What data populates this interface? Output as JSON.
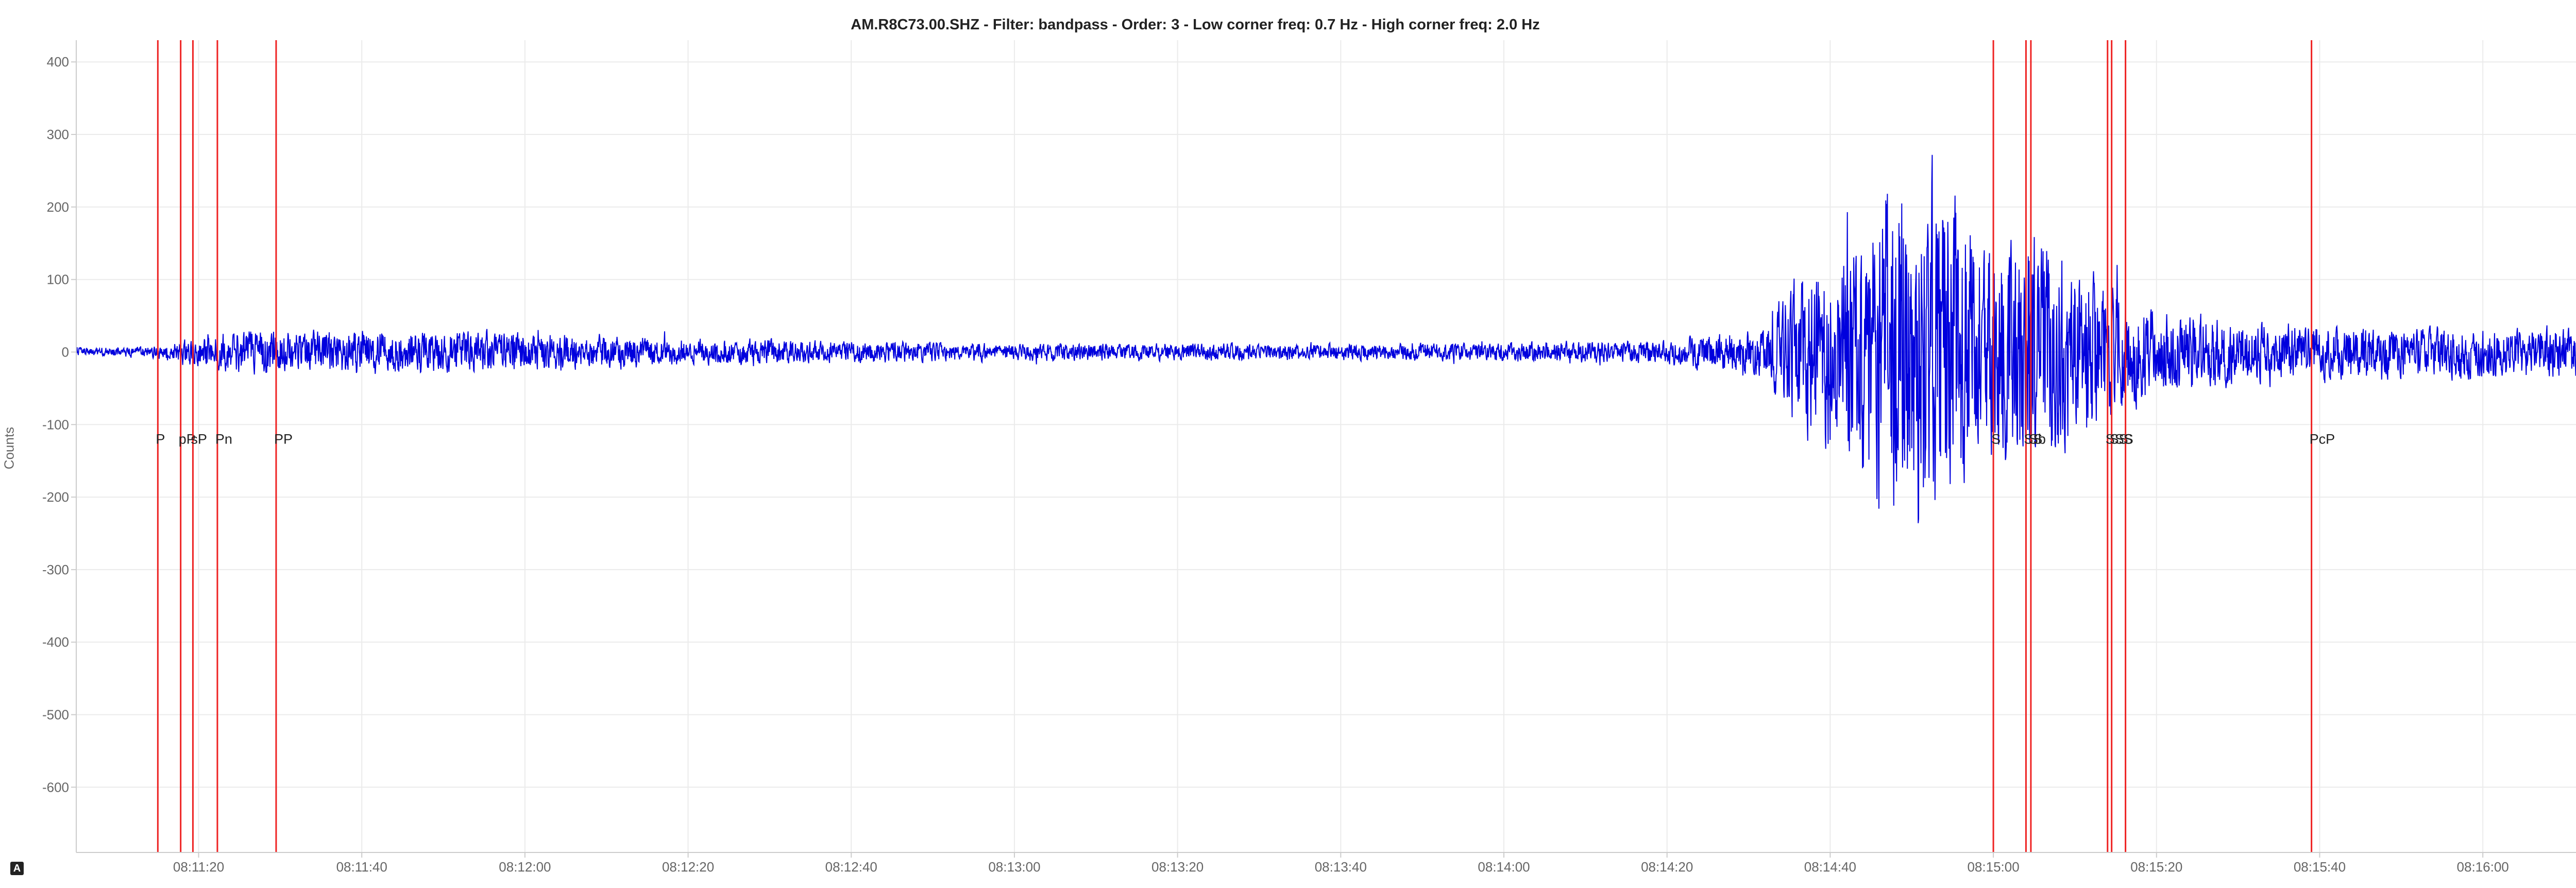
{
  "chart_data": {
    "type": "line",
    "title": "AM.R8C73.00.SHZ - Filter: bandpass - Order: 3 - Low corner freq: 0.7 Hz - High corner freq: 2.0 Hz",
    "ylabel": "Counts",
    "xlabel": "",
    "y_ticks": [
      400,
      300,
      200,
      100,
      0,
      -100,
      -200,
      -300,
      -400,
      -500,
      -600
    ],
    "ylim": [
      -690,
      430
    ],
    "x_range": [
      "08:11:05",
      "08:16:19"
    ],
    "x_ticks": [
      "08:11:20",
      "08:11:40",
      "08:12:00",
      "08:12:20",
      "08:12:40",
      "08:13:00",
      "08:13:20",
      "08:13:40",
      "08:14:00",
      "08:14:20",
      "08:14:40",
      "08:15:00",
      "08:15:20",
      "08:15:40",
      "08:16:00",
      "0"
    ],
    "x_tick_seconds": [
      15,
      35,
      55,
      75,
      95,
      115,
      135,
      155,
      175,
      195,
      215,
      235,
      255,
      275,
      295,
      314
    ],
    "grid": true,
    "series": [
      {
        "color": "#0000dd",
        "envelope": [
          {
            "t": "08:11:05",
            "amplitude": 8
          },
          {
            "t": "08:11:14",
            "amplitude": 10
          },
          {
            "t": "08:11:18",
            "amplitude": 20
          },
          {
            "t": "08:11:24",
            "amplitude": 38
          },
          {
            "t": "08:11:40",
            "amplitude": 40
          },
          {
            "t": "08:12:00",
            "amplitude": 36
          },
          {
            "t": "08:12:20",
            "amplitude": 25
          },
          {
            "t": "08:12:40",
            "amplitude": 20
          },
          {
            "t": "08:13:00",
            "amplitude": 16
          },
          {
            "t": "08:13:20",
            "amplitude": 16
          },
          {
            "t": "08:13:40",
            "amplitude": 15
          },
          {
            "t": "08:14:00",
            "amplitude": 17
          },
          {
            "t": "08:14:20",
            "amplitude": 22
          },
          {
            "t": "08:14:32",
            "amplitude": 45
          },
          {
            "t": "08:14:36",
            "amplitude": 140
          },
          {
            "t": "08:14:42",
            "amplitude": 200
          },
          {
            "t": "08:14:50",
            "amplitude": 340
          },
          {
            "t": "08:14:54",
            "amplitude": 290
          },
          {
            "t": "08:15:00",
            "amplitude": 190
          },
          {
            "t": "08:15:04",
            "amplitude": 240
          },
          {
            "t": "08:15:08",
            "amplitude": 180
          },
          {
            "t": "08:15:14",
            "amplitude": 130
          },
          {
            "t": "08:15:20",
            "amplitude": 75
          },
          {
            "t": "08:15:30",
            "amplitude": 55
          },
          {
            "t": "08:15:50",
            "amplitude": 45
          },
          {
            "t": "08:16:19",
            "amplitude": 48
          }
        ]
      }
    ],
    "phase_markers": [
      {
        "label": "P",
        "t": "08:11:15"
      },
      {
        "label": "pP",
        "t": "08:11:17.8"
      },
      {
        "label": "sP",
        "t": "08:11:19.3"
      },
      {
        "label": "Pn",
        "t": "08:11:22.3"
      },
      {
        "label": "PP",
        "t": "08:11:29.5"
      },
      {
        "label": "S",
        "t": "08:15:00"
      },
      {
        "label": "SS",
        "t": "08:15:04"
      },
      {
        "label": "Sb",
        "t": "08:15:04.6"
      },
      {
        "label": "SSS",
        "t": "08:15:14"
      },
      {
        "label": "SS",
        "t": "08:15:14.5"
      },
      {
        "label": "S",
        "t": "08:15:16.2"
      },
      {
        "label": "PcP",
        "t": "08:15:39"
      }
    ],
    "marker_color": "#ee2222"
  },
  "badge": {
    "label": "A"
  }
}
